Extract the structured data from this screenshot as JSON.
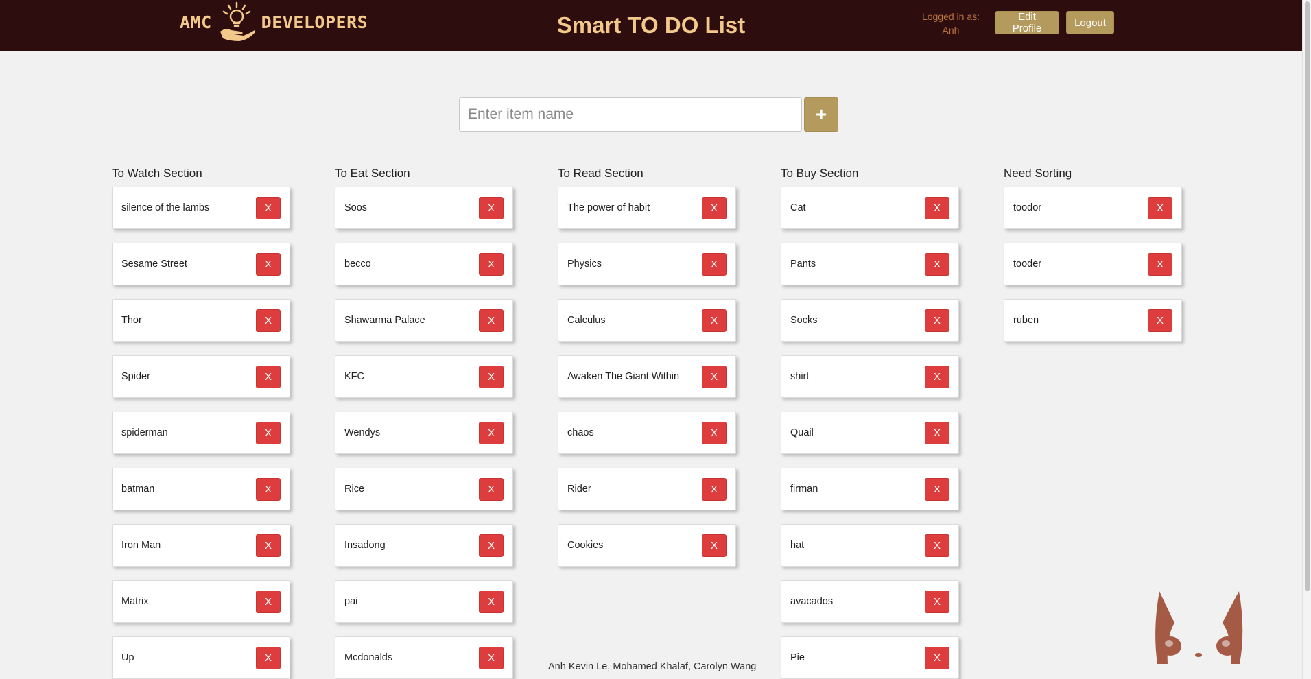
{
  "header": {
    "logo_left": "AMC",
    "logo_right": "DEVELOPERS",
    "title": "Smart TO DO List",
    "logged_in_label": "Logged in as:",
    "username": "Anh",
    "edit_profile_label": "Edit Profile",
    "logout_label": "Logout"
  },
  "add_form": {
    "placeholder": "Enter item name",
    "add_label": "+"
  },
  "delete_label": "X",
  "sections": [
    {
      "title": "To Watch Section",
      "items": [
        "silence of the lambs",
        "Sesame Street",
        "Thor",
        "Spider",
        "spiderman",
        "batman",
        "Iron Man",
        "Matrix",
        "Up"
      ]
    },
    {
      "title": "To Eat Section",
      "items": [
        "Soos",
        "becco",
        "Shawarma Palace",
        "KFC",
        "Wendys",
        "Rice",
        "Insadong",
        "pai",
        "Mcdonalds"
      ]
    },
    {
      "title": "To Read Section",
      "items": [
        "The power of habit",
        "Physics",
        "Calculus",
        "Awaken The Giant Within",
        "chaos",
        "Rider",
        "Cookies"
      ]
    },
    {
      "title": "To Buy Section",
      "items": [
        "Cat",
        "Pants",
        "Socks",
        "shirt",
        "Quail",
        "firman",
        "hat",
        "avacados",
        "Pie"
      ]
    },
    {
      "title": "Need Sorting",
      "items": [
        "toodor",
        "tooder",
        "ruben"
      ]
    }
  ],
  "footer": {
    "credits": "Anh Kevin Le, Mohamed Khalaf, Carolyn Wang"
  },
  "colors": {
    "header_bg": "#2e0d0e",
    "accent_gold": "#b59a5e",
    "title_text": "#f3c98b",
    "delete_red": "#dd3d3d",
    "mascot": "#a55a45"
  }
}
